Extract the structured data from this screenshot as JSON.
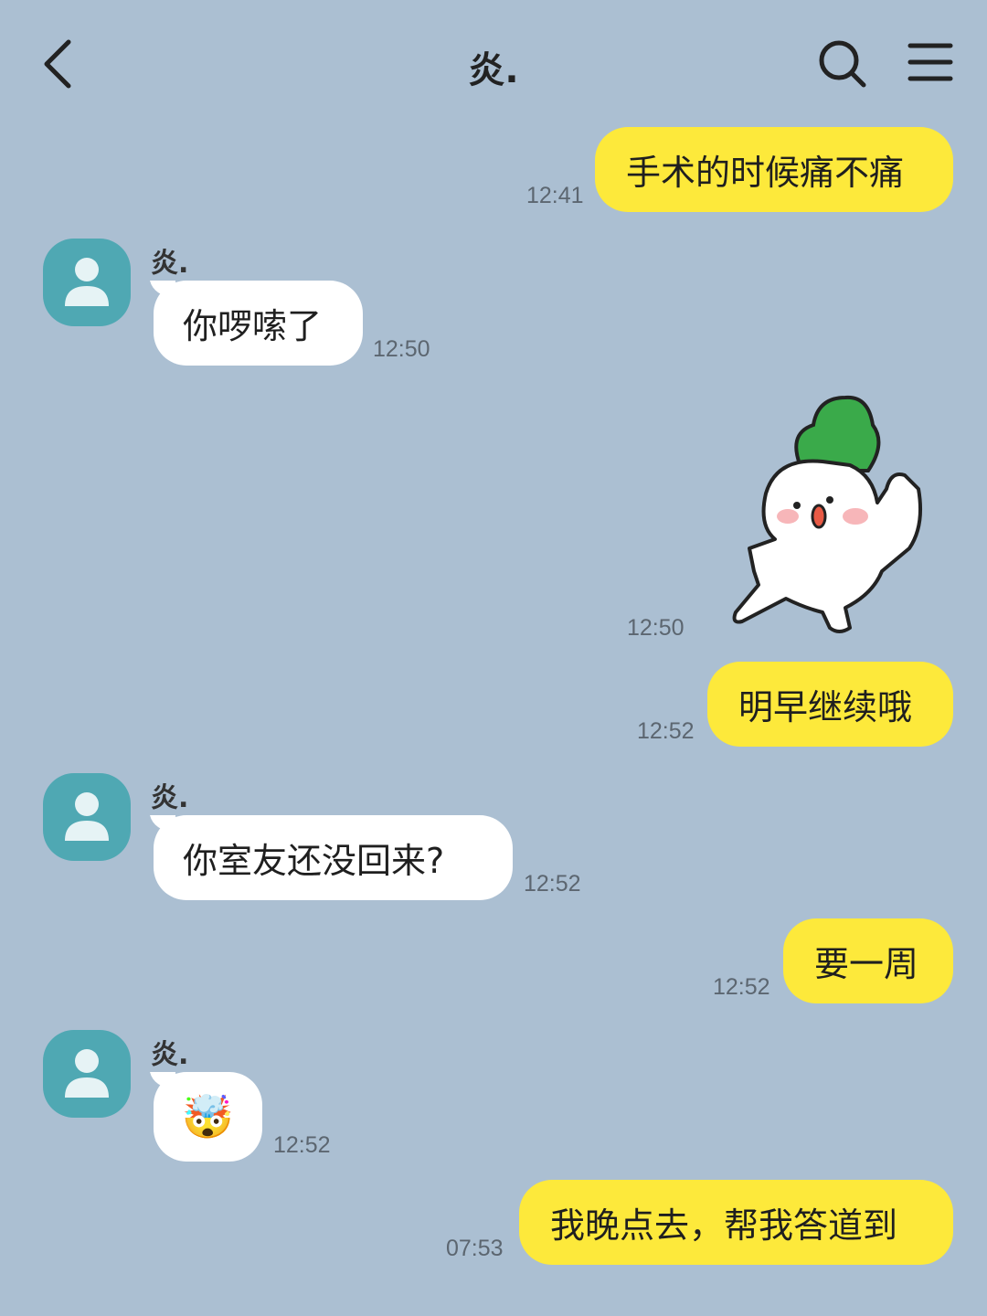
{
  "header": {
    "title": "炎."
  },
  "messages": [
    {
      "from": "me",
      "text": "手术的时候痛不痛",
      "time": "12:41"
    },
    {
      "from": "other",
      "sender": "炎.",
      "text": "你啰嗦了",
      "time": "12:50"
    },
    {
      "from": "me",
      "type": "sticker",
      "sticker": "radish-waving-sticker",
      "time": "12:50"
    },
    {
      "from": "me",
      "text": "明早继续哦",
      "time": "12:52"
    },
    {
      "from": "other",
      "sender": "炎.",
      "text": "你室友还没回来?",
      "time": "12:52"
    },
    {
      "from": "me",
      "text": "要一周",
      "time": "12:52"
    },
    {
      "from": "other",
      "sender": "炎.",
      "type": "emoji",
      "emoji": "🤯",
      "time": "12:52"
    },
    {
      "from": "me",
      "text": "我晚点去，帮我答道到",
      "time": "07:53"
    }
  ],
  "colors": {
    "background": "#abbfd2",
    "my_bubble": "#fde93b",
    "their_bubble": "#ffffff",
    "avatar": "#4fa8b3"
  },
  "icons": {
    "back": "back-arrow-icon",
    "search": "search-icon",
    "menu": "menu-icon",
    "avatar": "person-icon"
  }
}
